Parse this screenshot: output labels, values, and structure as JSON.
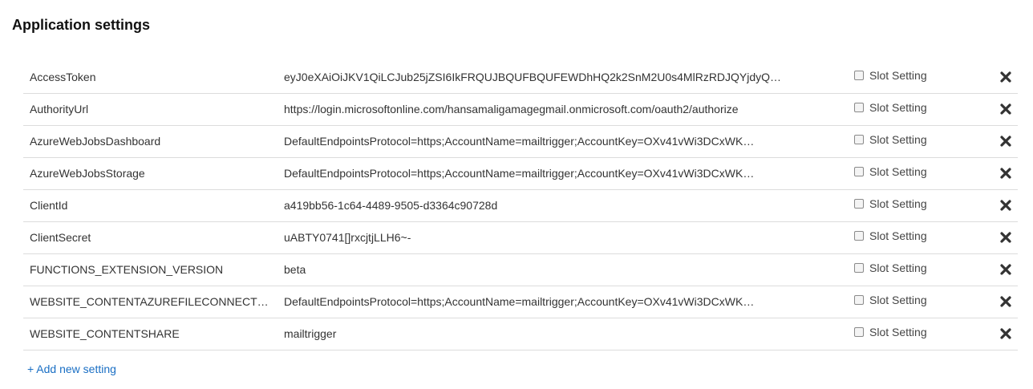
{
  "page": {
    "title": "Application settings"
  },
  "settings": {
    "slot_label": "Slot Setting",
    "rows": [
      {
        "name": "AccessToken",
        "value": "eyJ0eXAiOiJKV1QiLCJub25jZSI6IkFRQUJBQUFBQUFEWDhHQ2k2SnM2U0s4MlRzRDJQYjdyQk…",
        "slot_checked": false
      },
      {
        "name": "AuthorityUrl",
        "value": "https://login.microsoftonline.com/hansamaligamagegmail.onmicrosoft.com/oauth2/authorize",
        "slot_checked": false
      },
      {
        "name": "AzureWebJobsDashboard",
        "value": "DefaultEndpointsProtocol=https;AccountName=mailtrigger;AccountKey=OXv41vWi3DCxWK…",
        "slot_checked": false
      },
      {
        "name": "AzureWebJobsStorage",
        "value": "DefaultEndpointsProtocol=https;AccountName=mailtrigger;AccountKey=OXv41vWi3DCxWK…",
        "slot_checked": false
      },
      {
        "name": "ClientId",
        "value": "a419bb56-1c64-4489-9505-d3364c90728d",
        "slot_checked": false
      },
      {
        "name": "ClientSecret",
        "value": "uABTY0741[]rxcjtjLLH6~-",
        "slot_checked": false
      },
      {
        "name": "FUNCTIONS_EXTENSION_VERSION",
        "value": "beta",
        "slot_checked": false
      },
      {
        "name": "WEBSITE_CONTENTAZUREFILECONNECTIO…",
        "value": "DefaultEndpointsProtocol=https;AccountName=mailtrigger;AccountKey=OXv41vWi3DCxWK…",
        "slot_checked": false
      },
      {
        "name": "WEBSITE_CONTENTSHARE",
        "value": "mailtrigger",
        "slot_checked": false
      }
    ]
  },
  "actions": {
    "add_label": "+ Add new setting"
  },
  "colors": {
    "link": "#1a6fc4",
    "divider": "#dcdcdc",
    "delete_icon": "#333333"
  },
  "icons": {
    "delete": "close-icon",
    "slot": "checkbox-icon"
  }
}
